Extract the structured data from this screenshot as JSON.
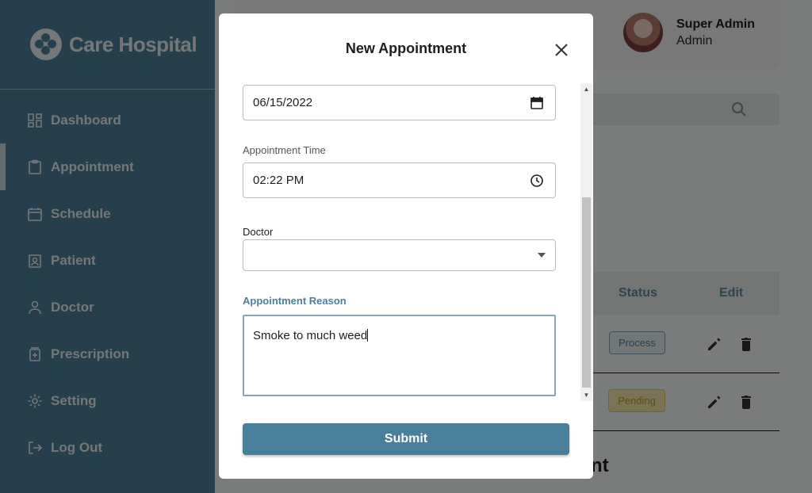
{
  "sidebar": {
    "brand": "Care Hospital",
    "items": [
      {
        "label": "Dashboard",
        "icon": "dashboard-icon"
      },
      {
        "label": "Appointment",
        "icon": "clipboard-icon",
        "active": true
      },
      {
        "label": "Schedule",
        "icon": "calendar-icon"
      },
      {
        "label": "Patient",
        "icon": "id-badge-icon"
      },
      {
        "label": "Doctor",
        "icon": "person-icon"
      },
      {
        "label": "Prescription",
        "icon": "medicine-icon"
      },
      {
        "label": "Setting",
        "icon": "gear-icon"
      },
      {
        "label": "Log Out",
        "icon": "logout-icon"
      }
    ]
  },
  "header": {
    "user_name": "Super Admin",
    "user_role": "Admin"
  },
  "table": {
    "columns": [
      "Status",
      "Edit"
    ],
    "rows": [
      {
        "status": "Process"
      },
      {
        "status": "Pending"
      }
    ]
  },
  "background_heading_fragment": "nt",
  "modal": {
    "title": "New Appointment",
    "date_value": "06/15/2022",
    "time_label": "Appointment Time",
    "time_value": "02:22 PM",
    "doctor_label": "Doctor",
    "doctor_value": "",
    "reason_label": "Appointment Reason",
    "reason_value": "Smoke to much weed",
    "submit_label": "Submit"
  },
  "colors": {
    "primary": "#4a7f9a",
    "pending": "#c99b1f"
  }
}
